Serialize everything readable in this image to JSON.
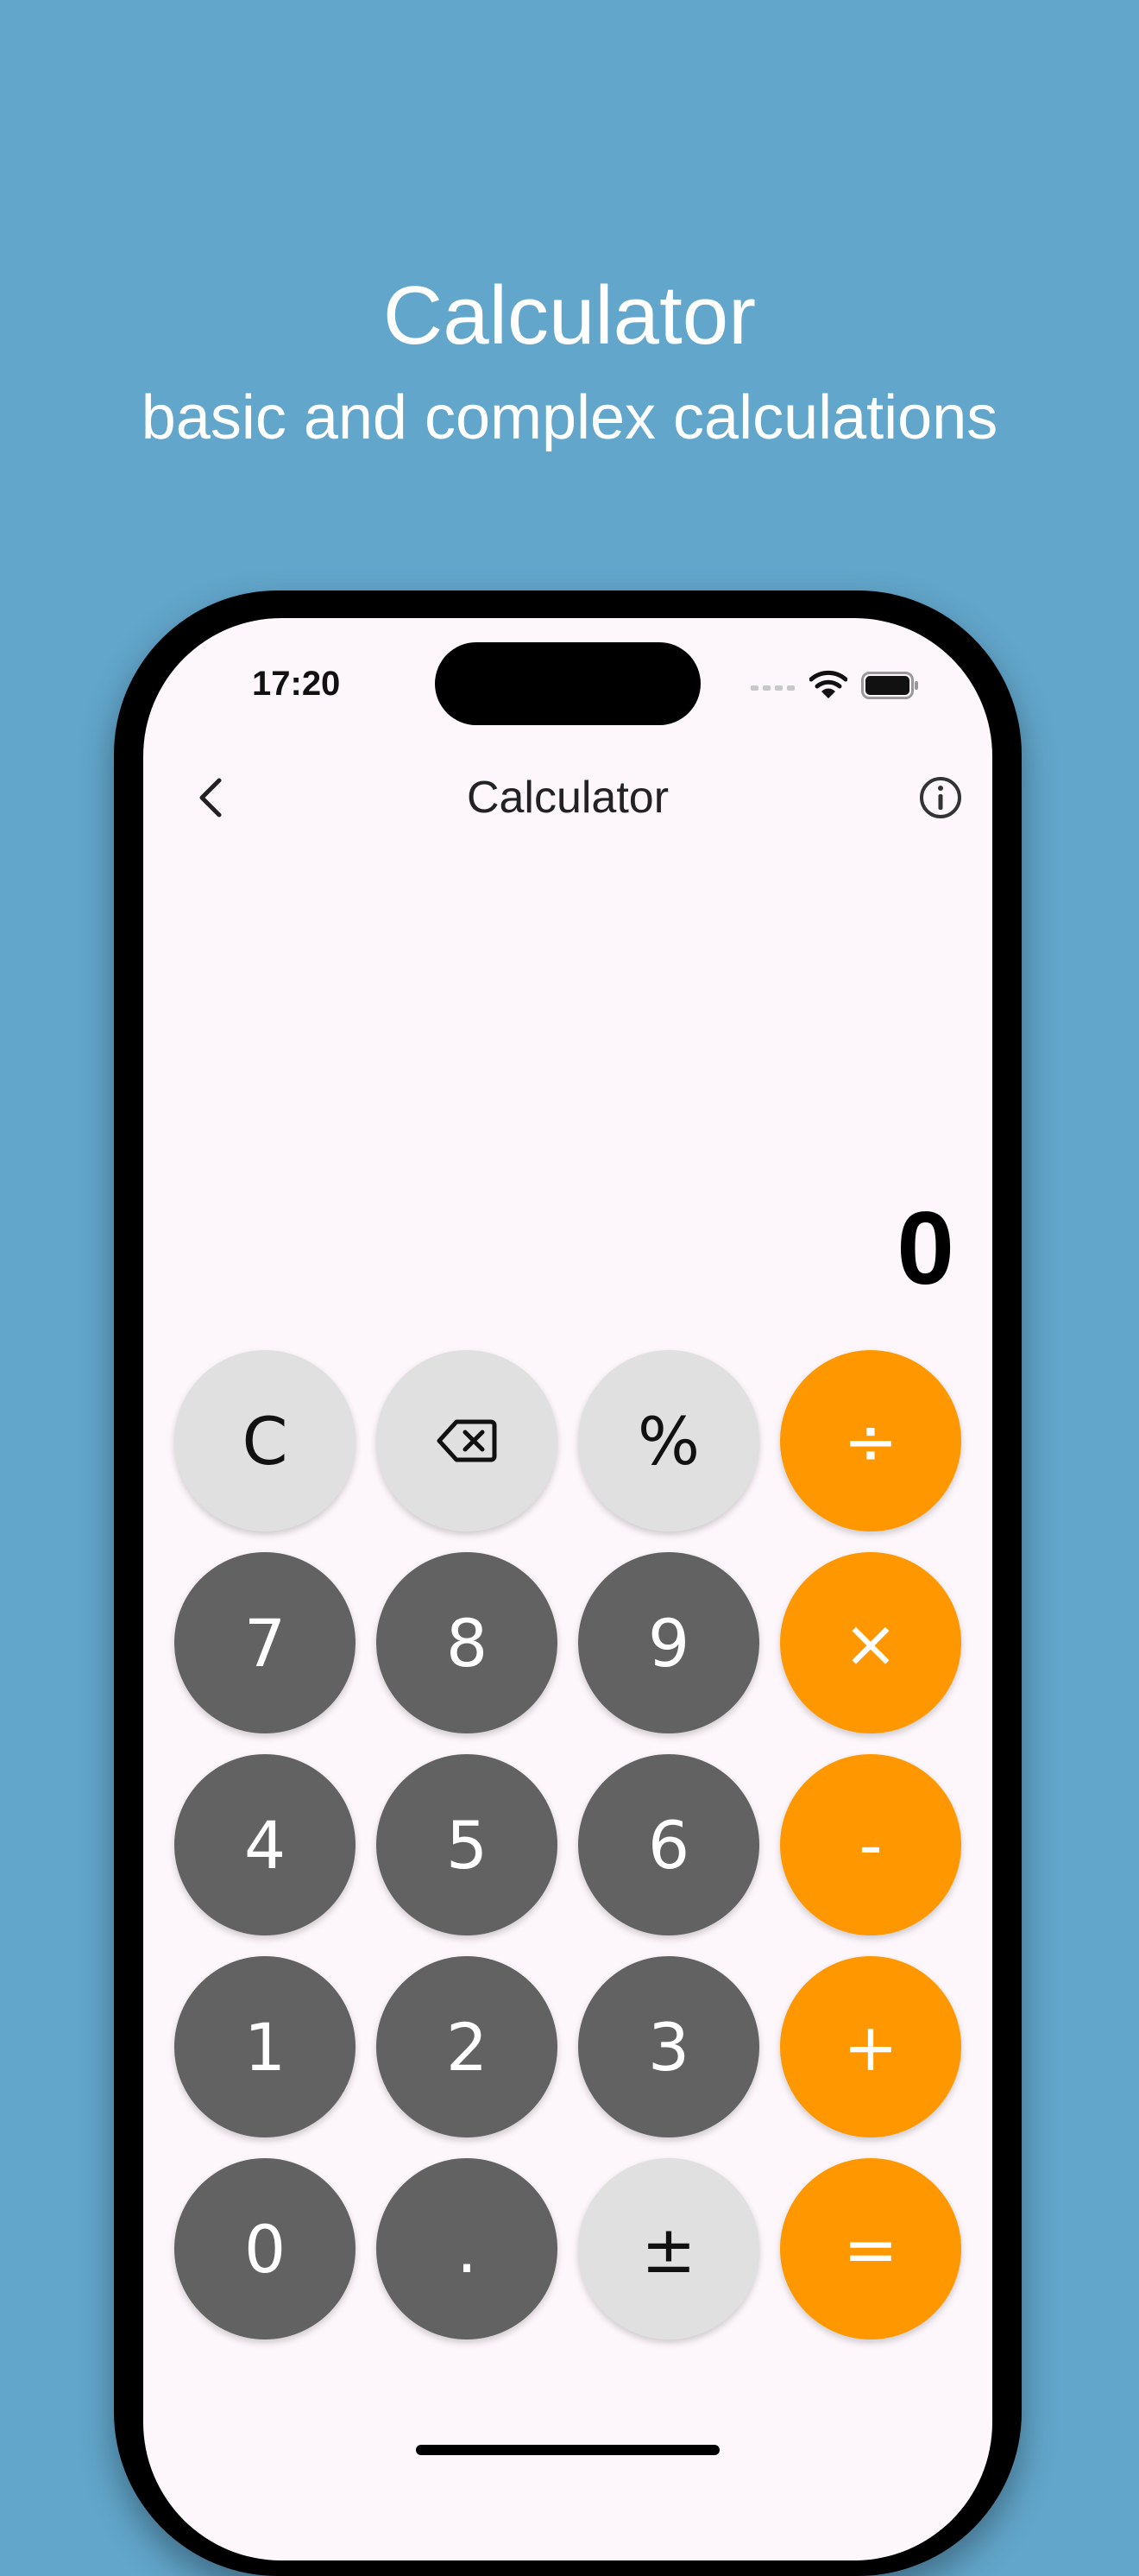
{
  "promo": {
    "title": "Calculator",
    "subtitle": "basic and complex calculations"
  },
  "status_bar": {
    "time": "17:20",
    "icons": [
      "signal-icon",
      "wifi-icon",
      "battery-icon"
    ]
  },
  "nav": {
    "title": "Calculator",
    "back_icon": "chevron-left-icon",
    "info_icon": "info-icon"
  },
  "display": {
    "value": "0"
  },
  "keypad": {
    "clear": "C",
    "backspace_icon": "backspace-icon",
    "percent": "%",
    "divide": "÷",
    "seven": "7",
    "eight": "8",
    "nine": "9",
    "multiply": "×",
    "four": "4",
    "five": "5",
    "six": "6",
    "minus": "-",
    "one": "1",
    "two": "2",
    "three": "3",
    "plus": "+",
    "zero": "0",
    "decimal": ".",
    "plus_minus": "±",
    "equals": "="
  },
  "colors": {
    "background": "#62A6CB",
    "screen": "#FDF7FB",
    "key_light": "#E0E0E0",
    "key_dark": "#626262",
    "key_operator": "#FF9800"
  }
}
